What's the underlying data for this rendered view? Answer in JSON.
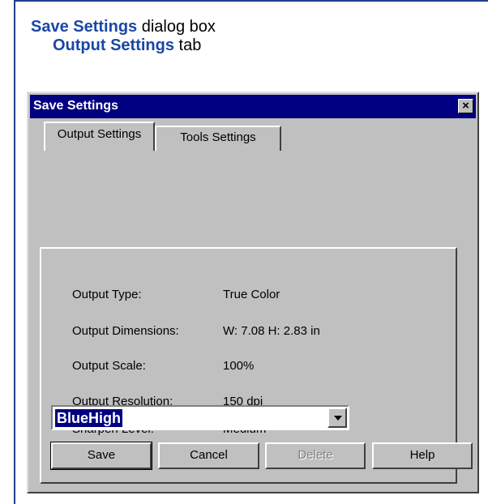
{
  "caption": {
    "line1_bold": "Save Settings",
    "line1_rest": " dialog box",
    "line2_bold": "Output Settings",
    "line2_rest": " tab"
  },
  "dialog": {
    "title": "Save Settings",
    "close_glyph": "×",
    "tabs": [
      {
        "label": "Output Settings",
        "active": true
      },
      {
        "label": "Tools Settings",
        "active": false
      }
    ],
    "fields": [
      {
        "label": "Output Type:",
        "value": "True Color"
      },
      {
        "label": "Output Dimensions:",
        "value": "W: 7.08 H: 2.83 in"
      },
      {
        "label": "Output Scale:",
        "value": "100%"
      },
      {
        "label": "Output Resolution:",
        "value": "150 dpi"
      },
      {
        "label": "Sharpen Level:",
        "value": "Medium"
      }
    ],
    "preset_combo": {
      "value": "BlueHigh"
    },
    "buttons": {
      "save": "Save",
      "cancel": "Cancel",
      "delete": "Delete",
      "help": "Help"
    }
  },
  "colors": {
    "accent_text": "#1a47a6",
    "titlebar": "#000080",
    "dialog_face": "#c0c0c0"
  }
}
